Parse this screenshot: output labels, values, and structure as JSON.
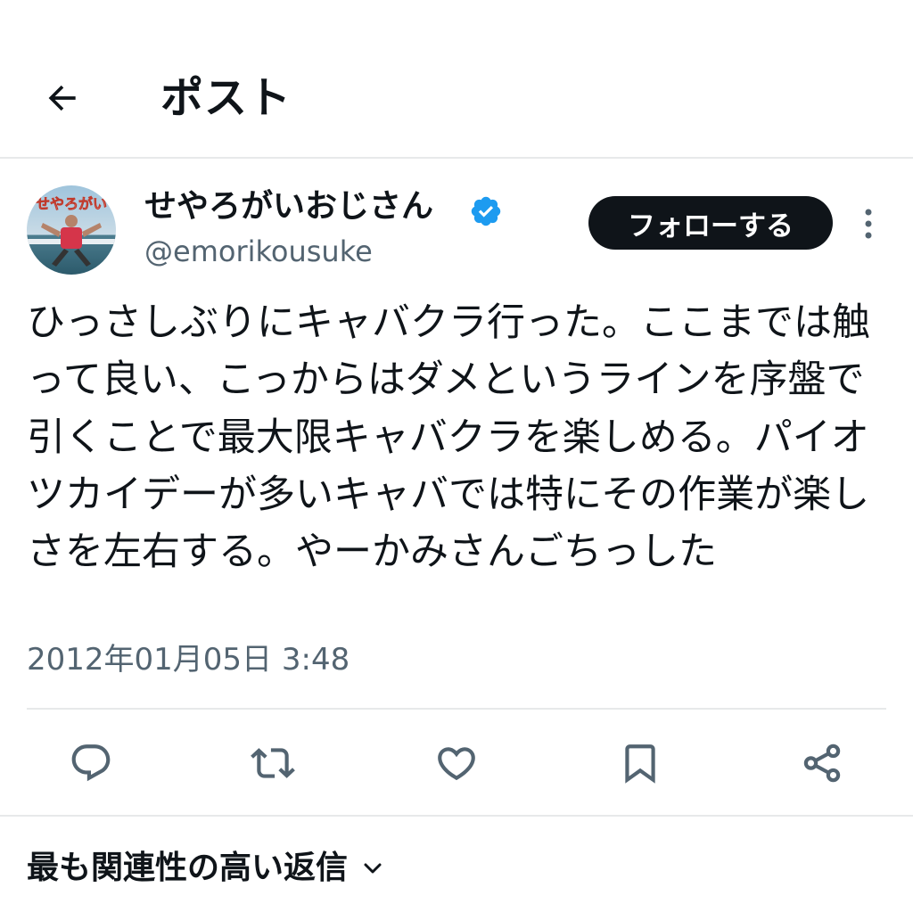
{
  "header": {
    "title": "ポスト",
    "back_icon": "arrow-left-icon"
  },
  "author": {
    "name": "せやろがいおじさん",
    "handle": "@emorikousuke",
    "avatar_text": "せやろがい",
    "verified": true,
    "verified_color": "#1d9bf0"
  },
  "follow_button": {
    "label": "フォローする"
  },
  "tweet": {
    "text": "ひっさしぶりにキャバクラ行った。ここまでは触って良い、こっからはダメというラインを序盤で引くことで最大限キャバクラを楽しめる。パイオツカイデーが多いキャバでは特にその作業が楽しさを左右する。やーかみさんごちっした",
    "timestamp": "2012年01月05日 3:48"
  },
  "actions": [
    {
      "name": "reply",
      "icon": "reply-icon"
    },
    {
      "name": "repost",
      "icon": "repost-icon"
    },
    {
      "name": "like",
      "icon": "heart-icon"
    },
    {
      "name": "bookmark",
      "icon": "bookmark-icon"
    },
    {
      "name": "share",
      "icon": "share-icon"
    }
  ],
  "replies_sort": {
    "label": "最も関連性の高い返信"
  },
  "colors": {
    "text": "#0f1419",
    "secondary_text": "#536471",
    "divider": "#e7e9ea",
    "follow_bg": "#0f1419",
    "icon": "#536471"
  }
}
